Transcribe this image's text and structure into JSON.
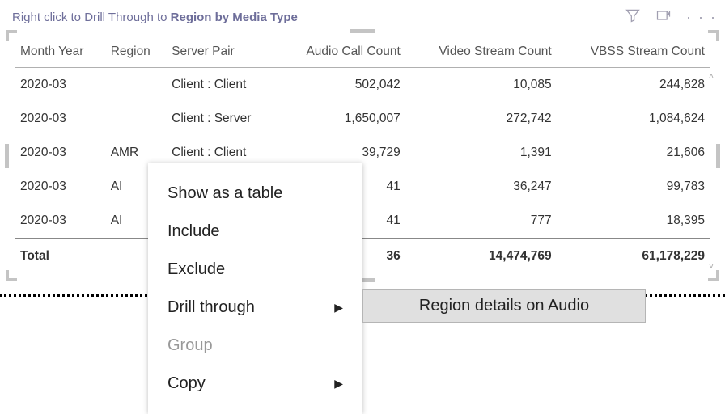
{
  "header": {
    "prefix_text": "Right click to Drill Through to ",
    "bold_text": "Region by Media Type"
  },
  "columns": {
    "c0": "Month Year",
    "c1": "Region",
    "c2": "Server Pair",
    "c3": "Audio Call Count",
    "c4": "Video Stream Count",
    "c5": "VBSS Stream Count"
  },
  "rows": [
    {
      "month": "2020-03",
      "region": "",
      "pair": "Client : Client",
      "audio": "502,042",
      "video": "10,085",
      "vbss": "244,828"
    },
    {
      "month": "2020-03",
      "region": "",
      "pair": "Client : Server",
      "audio": "1,650,007",
      "video": "272,742",
      "vbss": "1,084,624"
    },
    {
      "month": "2020-03",
      "region": "AMR",
      "pair": "Client : Client",
      "audio": "39,729",
      "video": "1,391",
      "vbss": "21,606"
    },
    {
      "month": "2020-03",
      "region": "AI",
      "pair": "",
      "audio": "41",
      "video": "36,247",
      "vbss": "99,783"
    },
    {
      "month": "2020-03",
      "region": "AI",
      "pair": "",
      "audio": "41",
      "video": "777",
      "vbss": "18,395"
    }
  ],
  "total": {
    "label": "Total",
    "audio": "36",
    "video": "14,474,769",
    "vbss": "61,178,229"
  },
  "context_menu": {
    "show_table": "Show as a table",
    "include": "Include",
    "exclude": "Exclude",
    "drill_through": "Drill through",
    "group": "Group",
    "copy": "Copy"
  },
  "submenu": {
    "region_audio": "Region details on Audio"
  }
}
